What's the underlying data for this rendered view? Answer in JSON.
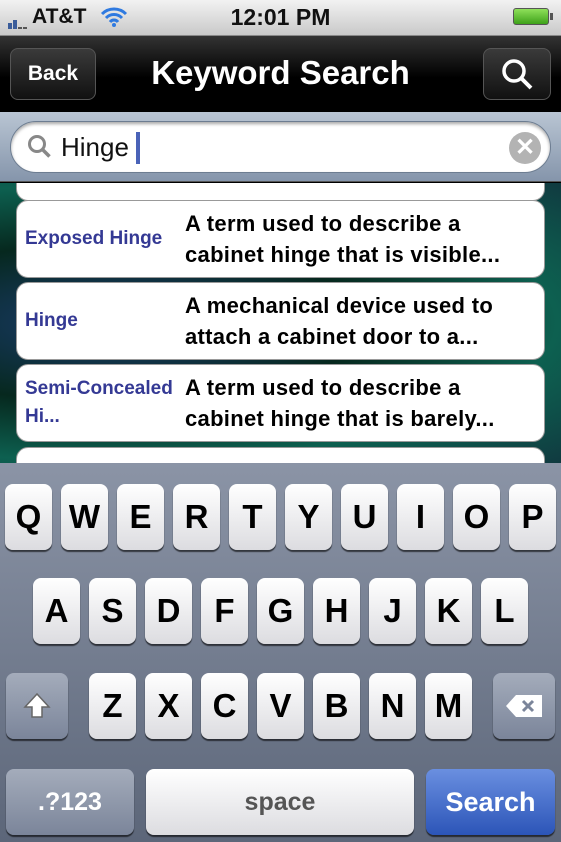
{
  "status": {
    "carrier": "AT&T",
    "time": "12:01 PM",
    "icons": [
      "signal-icon",
      "wifi-icon",
      "battery-icon"
    ]
  },
  "nav": {
    "back_label": "Back",
    "title": "Keyword Search",
    "search_icon": "search-icon"
  },
  "search": {
    "value": "Hinge",
    "icon": "search-icon",
    "clear_icon": "clear-icon"
  },
  "results": [
    {
      "term": "Exposed Hinge",
      "definition": "A term used to describe a cabinet hinge that is visible..."
    },
    {
      "term": "Hinge",
      "definition": "A mechanical device used to attach a cabinet door to a..."
    },
    {
      "term": "Semi-Concealed Hi...",
      "definition": "A term used to describe a cabinet hinge that is barely..."
    }
  ],
  "keyboard": {
    "row1": [
      "Q",
      "W",
      "E",
      "R",
      "T",
      "Y",
      "U",
      "I",
      "O",
      "P"
    ],
    "row2": [
      "A",
      "S",
      "D",
      "F",
      "G",
      "H",
      "J",
      "K",
      "L"
    ],
    "row3": [
      "Z",
      "X",
      "C",
      "V",
      "B",
      "N",
      "M"
    ],
    "numbers_label": ".?123",
    "space_label": "space",
    "search_label": "Search",
    "shift_icon": "shift-icon",
    "delete_icon": "delete-icon"
  },
  "colors": {
    "term": "#343994",
    "search_key": "#2c55b8"
  }
}
